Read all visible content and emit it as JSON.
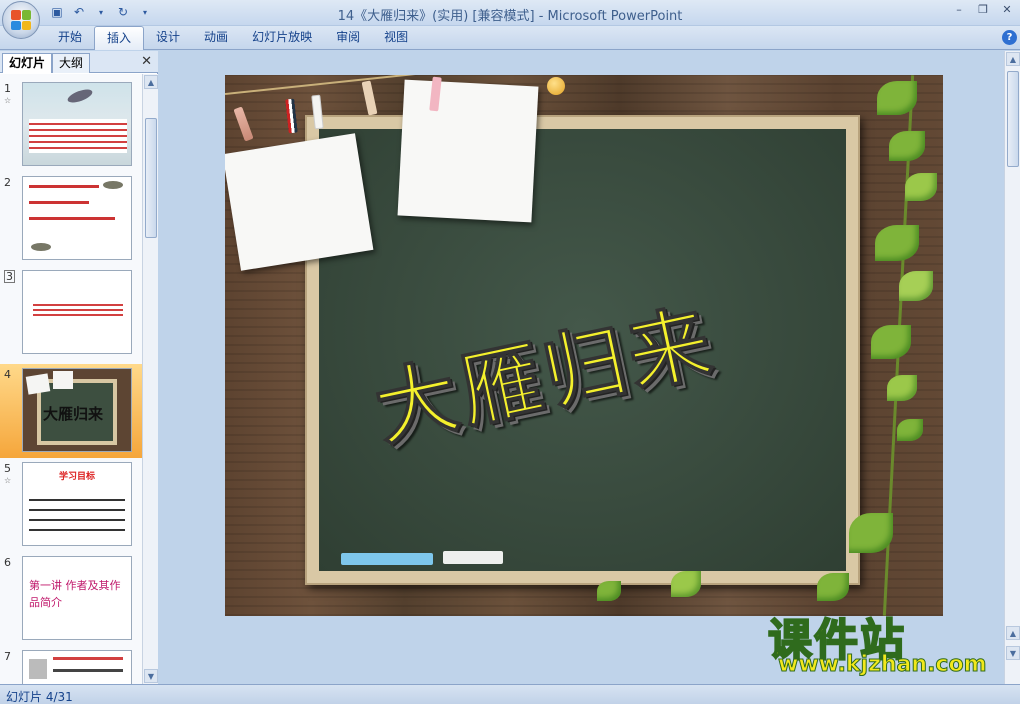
{
  "window": {
    "title": "14《大雁归来》(实用) [兼容模式] - Microsoft PowerPoint"
  },
  "ribbon": {
    "tabs": [
      {
        "label": "开始"
      },
      {
        "label": "插入"
      },
      {
        "label": "设计"
      },
      {
        "label": "动画"
      },
      {
        "label": "幻灯片放映"
      },
      {
        "label": "审阅"
      },
      {
        "label": "视图"
      }
    ],
    "active_tab": "插入"
  },
  "left_pane": {
    "tabs": [
      {
        "label": "幻灯片"
      },
      {
        "label": "大纲"
      }
    ],
    "thumbnails": [
      {
        "number": "1",
        "title": ""
      },
      {
        "number": "2",
        "title": ""
      },
      {
        "number": "3",
        "title": ""
      },
      {
        "number": "4",
        "title": "大雁归来"
      },
      {
        "number": "5",
        "title": "学习目标"
      },
      {
        "number": "6",
        "title": "第一讲 作者及其作品简介"
      },
      {
        "number": "7",
        "title": ""
      }
    ],
    "selected_slide": 4
  },
  "slide": {
    "title": "大雁归来"
  },
  "watermark": {
    "text": "课件站",
    "url": "www.kjzhan.com"
  },
  "status_bar": {
    "slide_info": "幻灯片 4/31"
  }
}
